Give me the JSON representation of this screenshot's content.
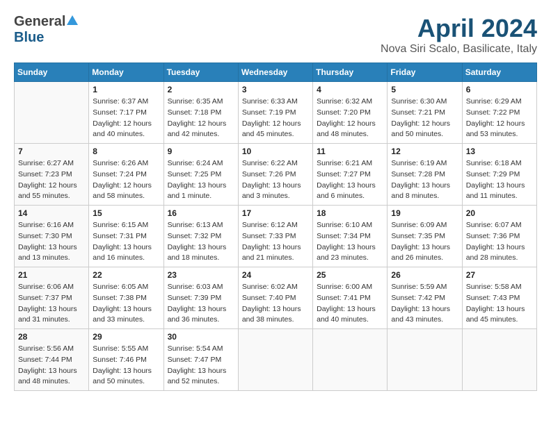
{
  "header": {
    "logo_general": "General",
    "logo_blue": "Blue",
    "title": "April 2024",
    "subtitle": "Nova Siri Scalo, Basilicate, Italy"
  },
  "weekdays": [
    "Sunday",
    "Monday",
    "Tuesday",
    "Wednesday",
    "Thursday",
    "Friday",
    "Saturday"
  ],
  "weeks": [
    [
      {
        "day": "",
        "info": ""
      },
      {
        "day": "1",
        "info": "Sunrise: 6:37 AM\nSunset: 7:17 PM\nDaylight: 12 hours\nand 40 minutes."
      },
      {
        "day": "2",
        "info": "Sunrise: 6:35 AM\nSunset: 7:18 PM\nDaylight: 12 hours\nand 42 minutes."
      },
      {
        "day": "3",
        "info": "Sunrise: 6:33 AM\nSunset: 7:19 PM\nDaylight: 12 hours\nand 45 minutes."
      },
      {
        "day": "4",
        "info": "Sunrise: 6:32 AM\nSunset: 7:20 PM\nDaylight: 12 hours\nand 48 minutes."
      },
      {
        "day": "5",
        "info": "Sunrise: 6:30 AM\nSunset: 7:21 PM\nDaylight: 12 hours\nand 50 minutes."
      },
      {
        "day": "6",
        "info": "Sunrise: 6:29 AM\nSunset: 7:22 PM\nDaylight: 12 hours\nand 53 minutes."
      }
    ],
    [
      {
        "day": "7",
        "info": "Sunrise: 6:27 AM\nSunset: 7:23 PM\nDaylight: 12 hours\nand 55 minutes."
      },
      {
        "day": "8",
        "info": "Sunrise: 6:26 AM\nSunset: 7:24 PM\nDaylight: 12 hours\nand 58 minutes."
      },
      {
        "day": "9",
        "info": "Sunrise: 6:24 AM\nSunset: 7:25 PM\nDaylight: 13 hours\nand 1 minute."
      },
      {
        "day": "10",
        "info": "Sunrise: 6:22 AM\nSunset: 7:26 PM\nDaylight: 13 hours\nand 3 minutes."
      },
      {
        "day": "11",
        "info": "Sunrise: 6:21 AM\nSunset: 7:27 PM\nDaylight: 13 hours\nand 6 minutes."
      },
      {
        "day": "12",
        "info": "Sunrise: 6:19 AM\nSunset: 7:28 PM\nDaylight: 13 hours\nand 8 minutes."
      },
      {
        "day": "13",
        "info": "Sunrise: 6:18 AM\nSunset: 7:29 PM\nDaylight: 13 hours\nand 11 minutes."
      }
    ],
    [
      {
        "day": "14",
        "info": "Sunrise: 6:16 AM\nSunset: 7:30 PM\nDaylight: 13 hours\nand 13 minutes."
      },
      {
        "day": "15",
        "info": "Sunrise: 6:15 AM\nSunset: 7:31 PM\nDaylight: 13 hours\nand 16 minutes."
      },
      {
        "day": "16",
        "info": "Sunrise: 6:13 AM\nSunset: 7:32 PM\nDaylight: 13 hours\nand 18 minutes."
      },
      {
        "day": "17",
        "info": "Sunrise: 6:12 AM\nSunset: 7:33 PM\nDaylight: 13 hours\nand 21 minutes."
      },
      {
        "day": "18",
        "info": "Sunrise: 6:10 AM\nSunset: 7:34 PM\nDaylight: 13 hours\nand 23 minutes."
      },
      {
        "day": "19",
        "info": "Sunrise: 6:09 AM\nSunset: 7:35 PM\nDaylight: 13 hours\nand 26 minutes."
      },
      {
        "day": "20",
        "info": "Sunrise: 6:07 AM\nSunset: 7:36 PM\nDaylight: 13 hours\nand 28 minutes."
      }
    ],
    [
      {
        "day": "21",
        "info": "Sunrise: 6:06 AM\nSunset: 7:37 PM\nDaylight: 13 hours\nand 31 minutes."
      },
      {
        "day": "22",
        "info": "Sunrise: 6:05 AM\nSunset: 7:38 PM\nDaylight: 13 hours\nand 33 minutes."
      },
      {
        "day": "23",
        "info": "Sunrise: 6:03 AM\nSunset: 7:39 PM\nDaylight: 13 hours\nand 36 minutes."
      },
      {
        "day": "24",
        "info": "Sunrise: 6:02 AM\nSunset: 7:40 PM\nDaylight: 13 hours\nand 38 minutes."
      },
      {
        "day": "25",
        "info": "Sunrise: 6:00 AM\nSunset: 7:41 PM\nDaylight: 13 hours\nand 40 minutes."
      },
      {
        "day": "26",
        "info": "Sunrise: 5:59 AM\nSunset: 7:42 PM\nDaylight: 13 hours\nand 43 minutes."
      },
      {
        "day": "27",
        "info": "Sunrise: 5:58 AM\nSunset: 7:43 PM\nDaylight: 13 hours\nand 45 minutes."
      }
    ],
    [
      {
        "day": "28",
        "info": "Sunrise: 5:56 AM\nSunset: 7:44 PM\nDaylight: 13 hours\nand 48 minutes."
      },
      {
        "day": "29",
        "info": "Sunrise: 5:55 AM\nSunset: 7:46 PM\nDaylight: 13 hours\nand 50 minutes."
      },
      {
        "day": "30",
        "info": "Sunrise: 5:54 AM\nSunset: 7:47 PM\nDaylight: 13 hours\nand 52 minutes."
      },
      {
        "day": "",
        "info": ""
      },
      {
        "day": "",
        "info": ""
      },
      {
        "day": "",
        "info": ""
      },
      {
        "day": "",
        "info": ""
      }
    ]
  ]
}
